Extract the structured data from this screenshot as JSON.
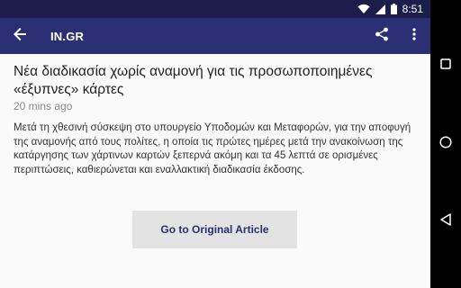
{
  "status_bar": {
    "time": "8:51",
    "icons": [
      "wifi-icon",
      "signal-icon",
      "battery-icon"
    ]
  },
  "app_bar": {
    "title": "IN.GR",
    "icons": [
      "back-arrow-icon",
      "share-icon",
      "more-vert-icon"
    ]
  },
  "article": {
    "title": "Νέα διαδικασία χωρίς αναμονή για τις προσωποποιημένες «έξυπνες» κάρτες",
    "time_ago": "20 mins ago",
    "body": "Μετά τη χθεσινή σύσκεψη στο υπουργείο Υποδομών και Μεταφορών, για την αποφυγή της αναμονής από τους πολίτες, η οποία τις πρώτες ημέρες μετά την ανακοίνωση της κατάργησης των χάρτινων καρτών ξεπερνά ακόμη και τα 45 λεπτά σε ορισμένες περιπτώσεις, καθιερώνεται και εναλλακτική διαδικασία έκδοσης.",
    "button_label": "Go to Original Article"
  },
  "nav_bar": {
    "icons": [
      "recents-square-icon",
      "home-circle-icon",
      "back-triangle-icon"
    ]
  },
  "colors": {
    "status_bar": "#1b1e4a",
    "app_bar": "#2b2f74",
    "background": "#fafafa",
    "button": "#e3e3e3",
    "button_text": "#2b2f74"
  }
}
